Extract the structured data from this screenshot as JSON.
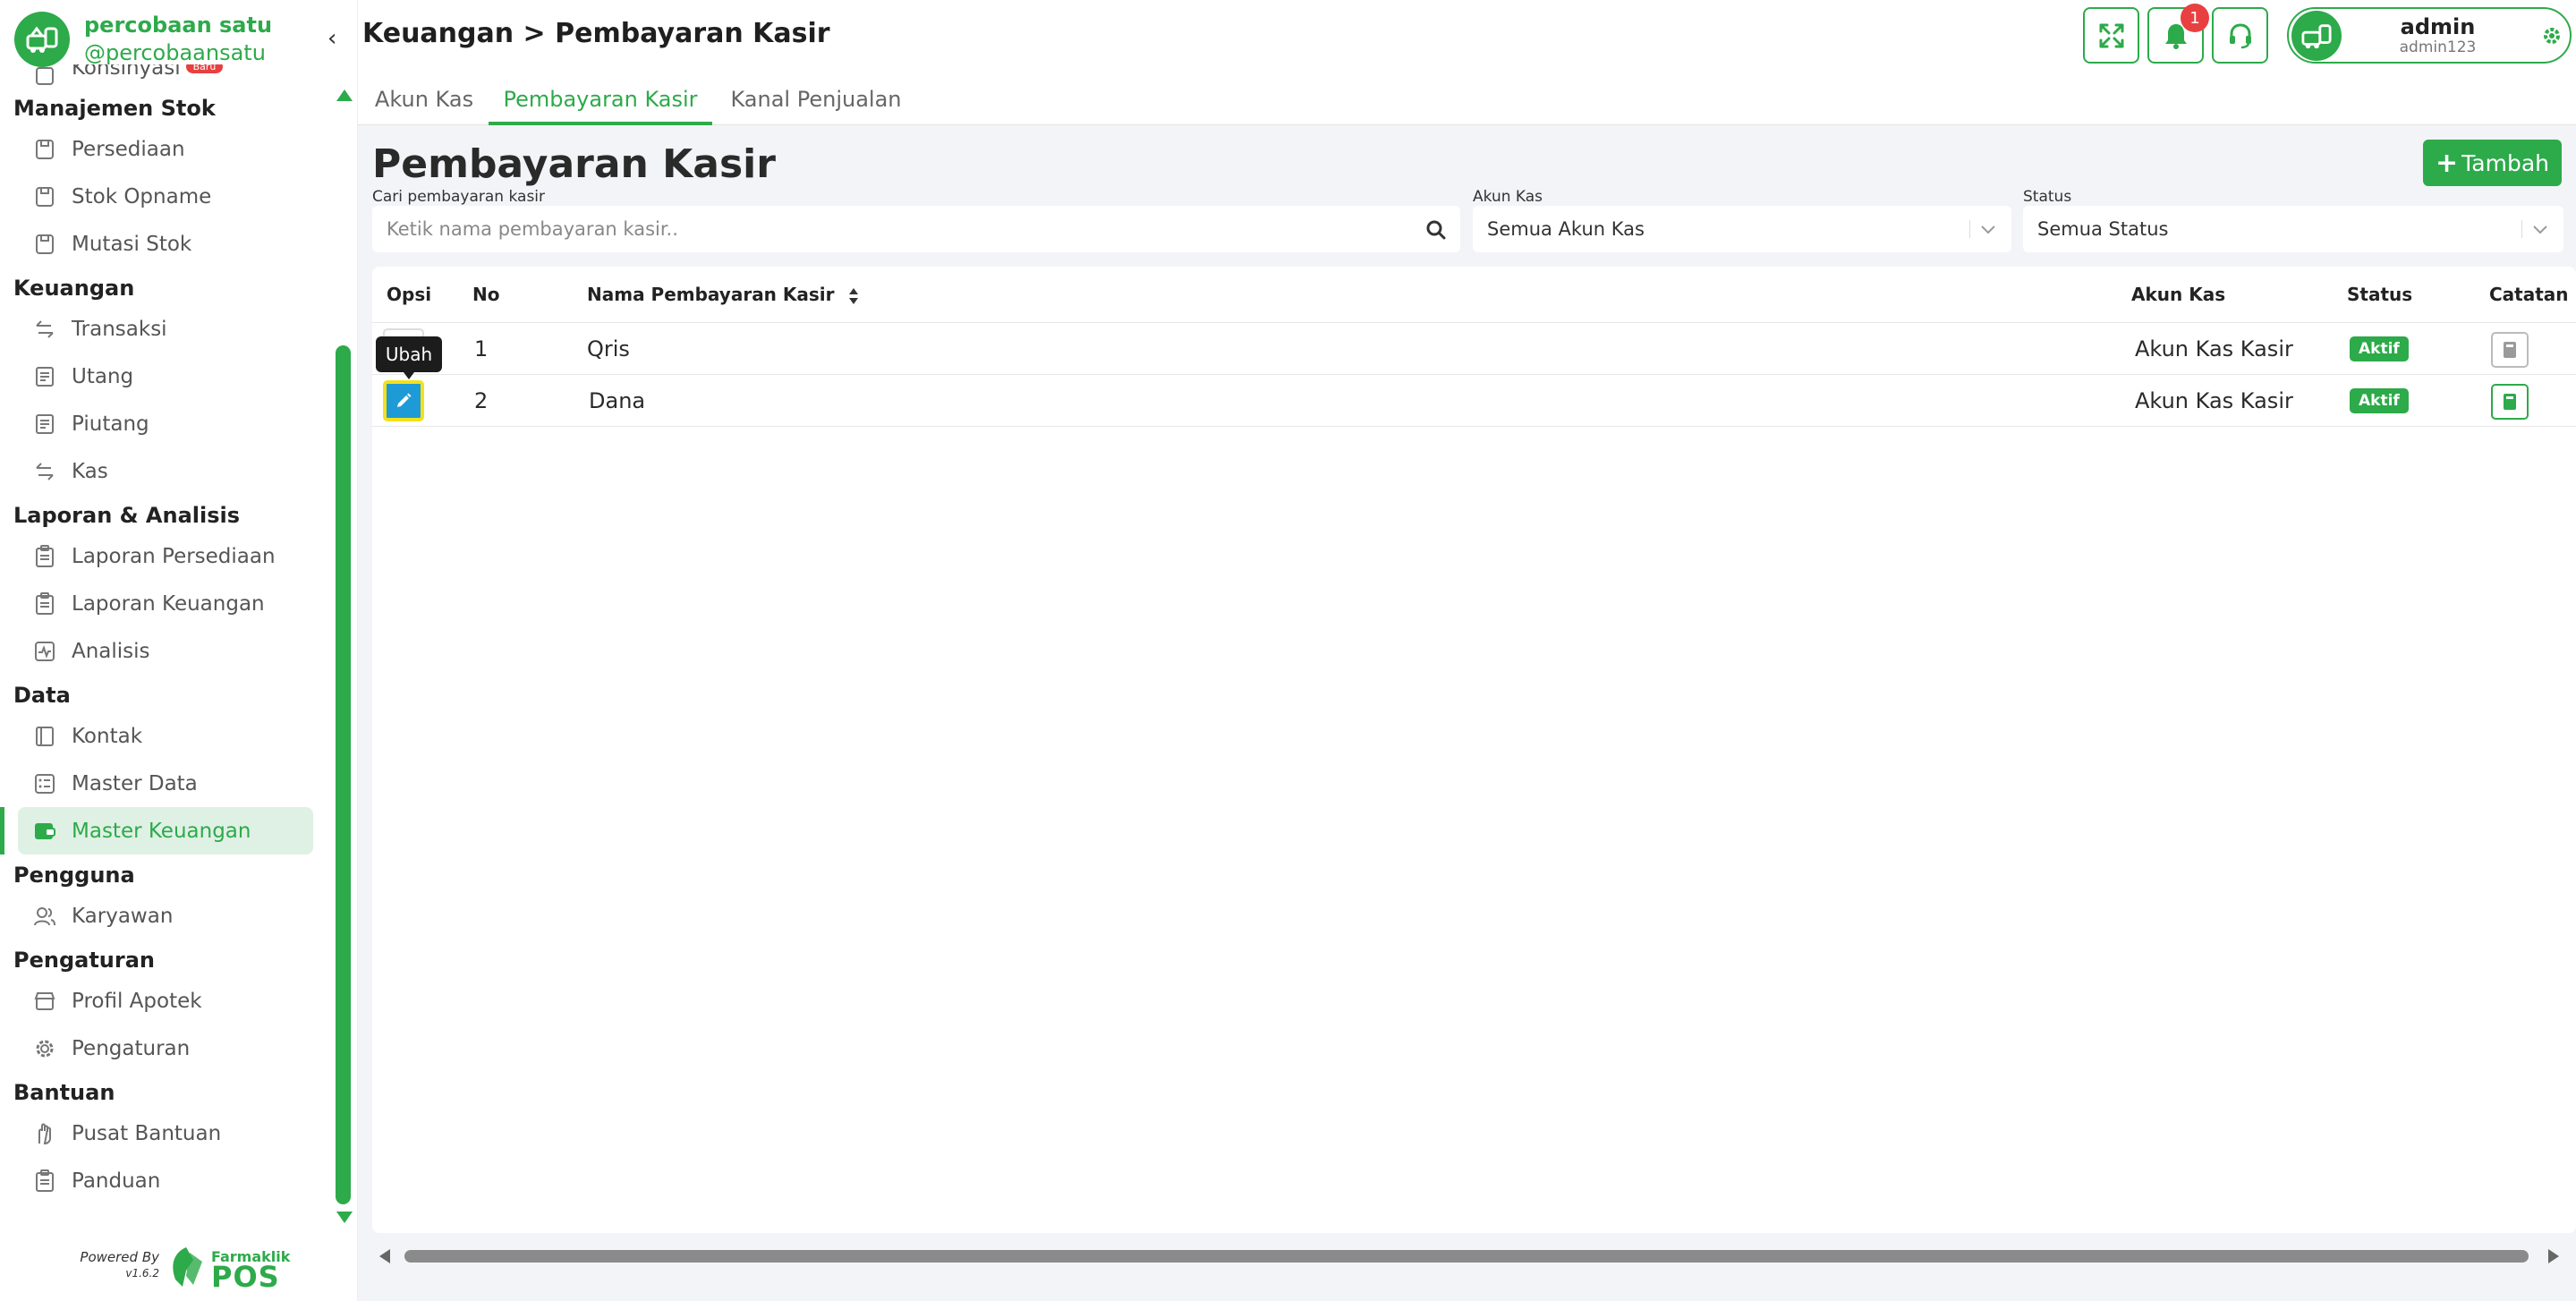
{
  "brand": {
    "name": "percobaan satu",
    "handle": "@percobaansatu"
  },
  "colors": {
    "accent": "#2daa4a",
    "edit_button": "#1e9ad6",
    "highlight": "#f4e01d",
    "badge_red": "#e84040"
  },
  "sidebar": {
    "partial_item": {
      "label": "Konsinyasi",
      "badge": "Baru"
    },
    "sections": [
      {
        "title": "Manajemen Stok",
        "items": [
          {
            "label": "Persediaan",
            "icon": "box-icon"
          },
          {
            "label": "Stok Opname",
            "icon": "box-icon"
          },
          {
            "label": "Mutasi Stok",
            "icon": "box-icon"
          }
        ]
      },
      {
        "title": "Keuangan",
        "items": [
          {
            "label": "Transaksi",
            "icon": "transfer-icon"
          },
          {
            "label": "Utang",
            "icon": "list-icon"
          },
          {
            "label": "Piutang",
            "icon": "list-icon"
          },
          {
            "label": "Kas",
            "icon": "transfer-icon"
          }
        ]
      },
      {
        "title": "Laporan & Analisis",
        "items": [
          {
            "label": "Laporan Persediaan",
            "icon": "clipboard-icon"
          },
          {
            "label": "Laporan Keuangan",
            "icon": "clipboard-icon"
          },
          {
            "label": "Analisis",
            "icon": "chart-icon"
          }
        ]
      },
      {
        "title": "Data",
        "items": [
          {
            "label": "Kontak",
            "icon": "contact-icon"
          },
          {
            "label": "Master Data",
            "icon": "database-icon"
          },
          {
            "label": "Master Keuangan",
            "icon": "wallet-icon",
            "active": true
          }
        ]
      },
      {
        "title": "Pengguna",
        "items": [
          {
            "label": "Karyawan",
            "icon": "users-icon"
          }
        ]
      },
      {
        "title": "Pengaturan",
        "items": [
          {
            "label": "Profil Apotek",
            "icon": "store-icon"
          },
          {
            "label": "Pengaturan",
            "icon": "gear-icon"
          }
        ]
      },
      {
        "title": "Bantuan",
        "items": [
          {
            "label": "Pusat Bantuan",
            "icon": "hand-icon"
          },
          {
            "label": "Panduan",
            "icon": "clipboard-icon"
          }
        ]
      }
    ],
    "powered_by": "Powered By",
    "version": "v1.6.2",
    "logo_small": "Farmaklik",
    "logo_big": "POS"
  },
  "header": {
    "breadcrumb": "Keuangan > Pembayaran Kasir",
    "notification_count": "1",
    "user_name": "admin",
    "user_id": "admin123"
  },
  "tabs": [
    {
      "label": "Akun Kas"
    },
    {
      "label": "Pembayaran Kasir",
      "active": true
    },
    {
      "label": "Kanal Penjualan"
    }
  ],
  "main": {
    "title": "Pembayaran Kasir",
    "add_button": "Tambah",
    "filters": {
      "search_label": "Cari pembayaran kasir",
      "search_placeholder": "Ketik nama pembayaran kasir..",
      "akun_label": "Akun Kas",
      "akun_value": "Semua Akun Kas",
      "status_label": "Status",
      "status_value": "Semua Status"
    },
    "table": {
      "columns": [
        "Opsi",
        "No",
        "Nama Pembayaran Kasir",
        "Akun Kas",
        "Status",
        "Catatan"
      ],
      "rows": [
        {
          "no": "1",
          "name": "Qris",
          "akun": "Akun Kas Kasir",
          "status": "Aktif"
        },
        {
          "no": "2",
          "name": "Dana",
          "akun": "Akun Kas Kasir",
          "status": "Aktif"
        }
      ]
    },
    "tooltip": "Ubah"
  }
}
